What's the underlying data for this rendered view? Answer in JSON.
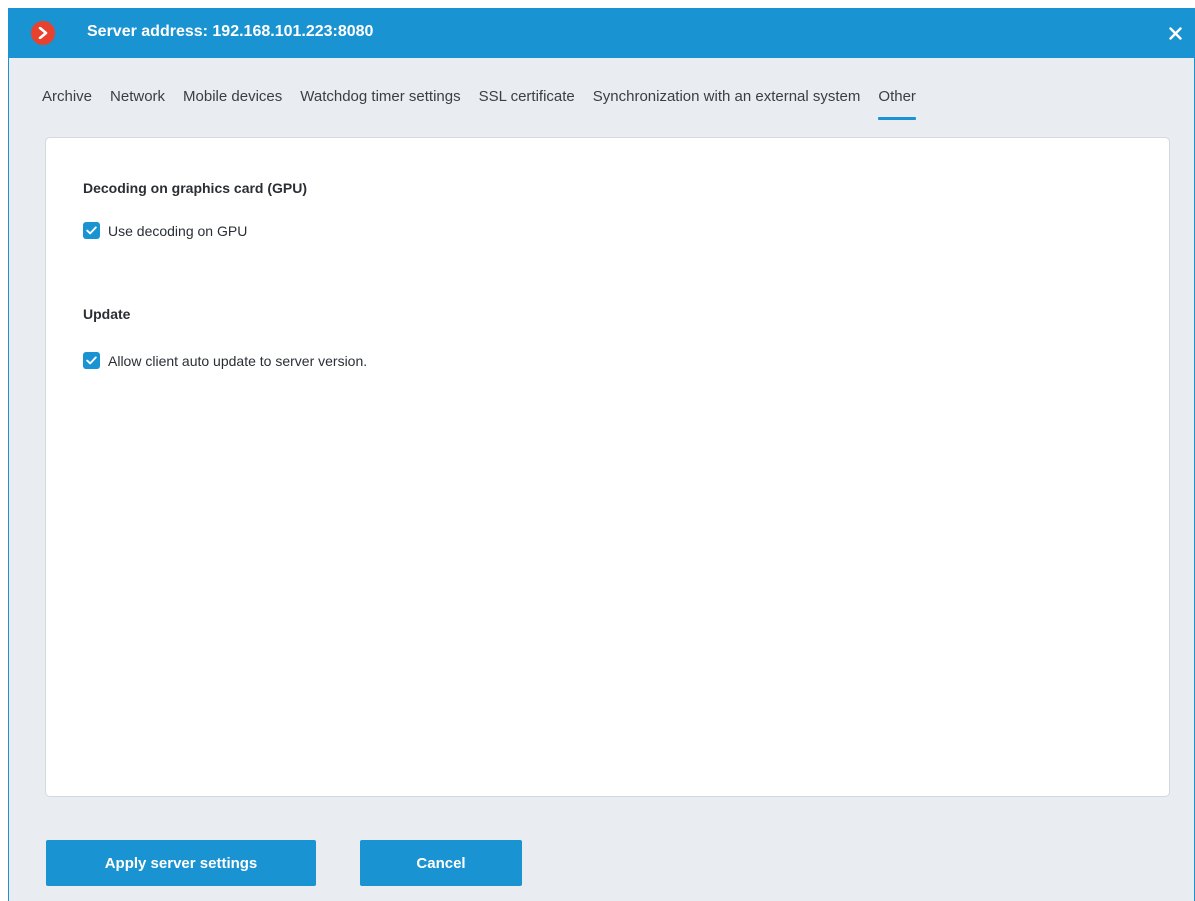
{
  "window": {
    "title": "Server address: 192.168.101.223:8080",
    "accent_color": "#1a93d2",
    "app_icon": "app-logo-icon",
    "close_icon": "close-icon"
  },
  "tabs": [
    {
      "label": "Archive",
      "active": false
    },
    {
      "label": "Network",
      "active": false
    },
    {
      "label": "Mobile devices",
      "active": false
    },
    {
      "label": "Watchdog timer settings",
      "active": false
    },
    {
      "label": "SSL certificate",
      "active": false
    },
    {
      "label": "Synchronization with an external system",
      "active": false
    },
    {
      "label": "Other",
      "active": true
    }
  ],
  "sections": {
    "gpu": {
      "title": "Decoding on graphics card (GPU)",
      "checkbox_label": "Use decoding on GPU",
      "checked": true
    },
    "update": {
      "title": "Update",
      "checkbox_label": "Allow client auto update to server version.",
      "checked": true
    }
  },
  "buttons": {
    "apply_label": "Apply server settings",
    "cancel_label": "Cancel"
  }
}
